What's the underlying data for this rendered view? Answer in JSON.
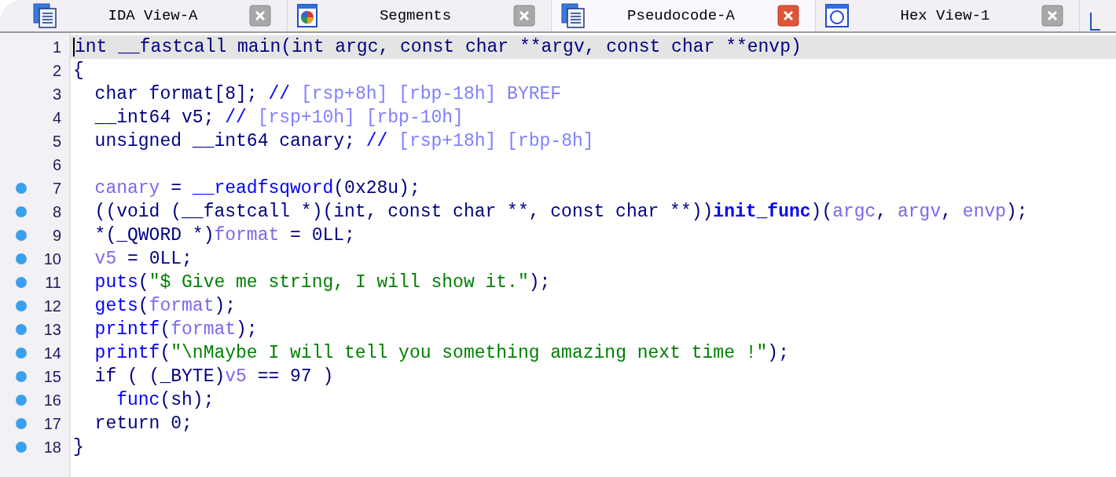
{
  "tabs": [
    {
      "label": "IDA View-A",
      "selected": false
    },
    {
      "label": "Segments",
      "selected": false
    },
    {
      "label": "Pseudocode-A",
      "selected": true
    },
    {
      "label": "Hex View-1",
      "selected": false
    }
  ],
  "code": {
    "lines": [
      {
        "number": "1",
        "breakpoint": false,
        "current": true,
        "tokens": [
          {
            "kind": "plain",
            "text": "int __fastcall main(int argc, const char **argv, const char **envp)"
          }
        ]
      },
      {
        "number": "2",
        "breakpoint": false,
        "current": false,
        "tokens": [
          {
            "kind": "plain",
            "text": "{"
          }
        ]
      },
      {
        "number": "3",
        "breakpoint": false,
        "current": false,
        "tokens": [
          {
            "kind": "plain",
            "text": "  char format[8]; "
          },
          {
            "kind": "comment",
            "text": "// "
          },
          {
            "kind": "note",
            "text": "[rsp+8h] [rbp-18h] BYREF"
          }
        ]
      },
      {
        "number": "4",
        "breakpoint": false,
        "current": false,
        "tokens": [
          {
            "kind": "plain",
            "text": "  __int64 v5; "
          },
          {
            "kind": "comment",
            "text": "// "
          },
          {
            "kind": "note",
            "text": "[rsp+10h] [rbp-10h]"
          }
        ]
      },
      {
        "number": "5",
        "breakpoint": false,
        "current": false,
        "tokens": [
          {
            "kind": "plain",
            "text": "  unsigned __int64 canary; "
          },
          {
            "kind": "comment",
            "text": "// "
          },
          {
            "kind": "note",
            "text": "[rsp+18h] [rbp-8h]"
          }
        ]
      },
      {
        "number": "6",
        "breakpoint": false,
        "current": false
      },
      {
        "number": "7",
        "breakpoint": true,
        "current": false,
        "tokens": [
          {
            "kind": "local",
            "text": "  canary"
          },
          {
            "kind": "plain",
            "text": " = "
          },
          {
            "kind": "func",
            "text": "__readfsqword"
          },
          {
            "kind": "plain",
            "text": "(0x28u);"
          }
        ]
      },
      {
        "number": "8",
        "breakpoint": true,
        "current": false,
        "tokens": [
          {
            "kind": "plain",
            "text": "  ((void (__fastcall *)(int, const char **, const char **))"
          },
          {
            "kind": "funcbold",
            "text": "init_func"
          },
          {
            "kind": "plain",
            "text": ")("
          },
          {
            "kind": "local",
            "text": "argc"
          },
          {
            "kind": "plain",
            "text": ", "
          },
          {
            "kind": "local",
            "text": "argv"
          },
          {
            "kind": "plain",
            "text": ", "
          },
          {
            "kind": "local",
            "text": "envp"
          },
          {
            "kind": "plain",
            "text": ");"
          }
        ]
      },
      {
        "number": "9",
        "breakpoint": true,
        "current": false,
        "tokens": [
          {
            "kind": "plain",
            "text": "  *(_QWORD *)"
          },
          {
            "kind": "local",
            "text": "format"
          },
          {
            "kind": "plain",
            "text": " = 0LL;"
          }
        ]
      },
      {
        "number": "10",
        "breakpoint": true,
        "current": false,
        "tokens": [
          {
            "kind": "local",
            "text": "  v5"
          },
          {
            "kind": "plain",
            "text": " = 0LL;"
          }
        ]
      },
      {
        "number": "11",
        "breakpoint": true,
        "current": false,
        "tokens": [
          {
            "kind": "func",
            "text": "  puts"
          },
          {
            "kind": "plain",
            "text": "("
          },
          {
            "kind": "string",
            "text": "\"$ Give me string, I will show it.\""
          },
          {
            "kind": "plain",
            "text": ");"
          }
        ]
      },
      {
        "number": "12",
        "breakpoint": true,
        "current": false,
        "tokens": [
          {
            "kind": "func",
            "text": "  gets"
          },
          {
            "kind": "plain",
            "text": "("
          },
          {
            "kind": "local",
            "text": "format"
          },
          {
            "kind": "plain",
            "text": ");"
          }
        ]
      },
      {
        "number": "13",
        "breakpoint": true,
        "current": false,
        "tokens": [
          {
            "kind": "func",
            "text": "  printf"
          },
          {
            "kind": "plain",
            "text": "("
          },
          {
            "kind": "local",
            "text": "format"
          },
          {
            "kind": "plain",
            "text": ");"
          }
        ]
      },
      {
        "number": "14",
        "breakpoint": true,
        "current": false,
        "tokens": [
          {
            "kind": "func",
            "text": "  printf"
          },
          {
            "kind": "plain",
            "text": "("
          },
          {
            "kind": "string",
            "text": "\"\\nMaybe I will tell you something amazing next time !\""
          },
          {
            "kind": "plain",
            "text": ");"
          }
        ]
      },
      {
        "number": "15",
        "breakpoint": true,
        "current": false,
        "tokens": [
          {
            "kind": "plain",
            "text": "  if ( (_BYTE)"
          },
          {
            "kind": "local",
            "text": "v5"
          },
          {
            "kind": "plain",
            "text": " == 97 )"
          }
        ]
      },
      {
        "number": "16",
        "breakpoint": true,
        "current": false,
        "tokens": [
          {
            "kind": "func",
            "text": "    func"
          },
          {
            "kind": "plain",
            "text": "(sh);"
          }
        ]
      },
      {
        "number": "17",
        "breakpoint": true,
        "current": false,
        "tokens": [
          {
            "kind": "plain",
            "text": "  return 0;"
          }
        ]
      },
      {
        "number": "18",
        "breakpoint": true,
        "current": false,
        "tokens": [
          {
            "kind": "plain",
            "text": "}"
          }
        ]
      }
    ]
  }
}
